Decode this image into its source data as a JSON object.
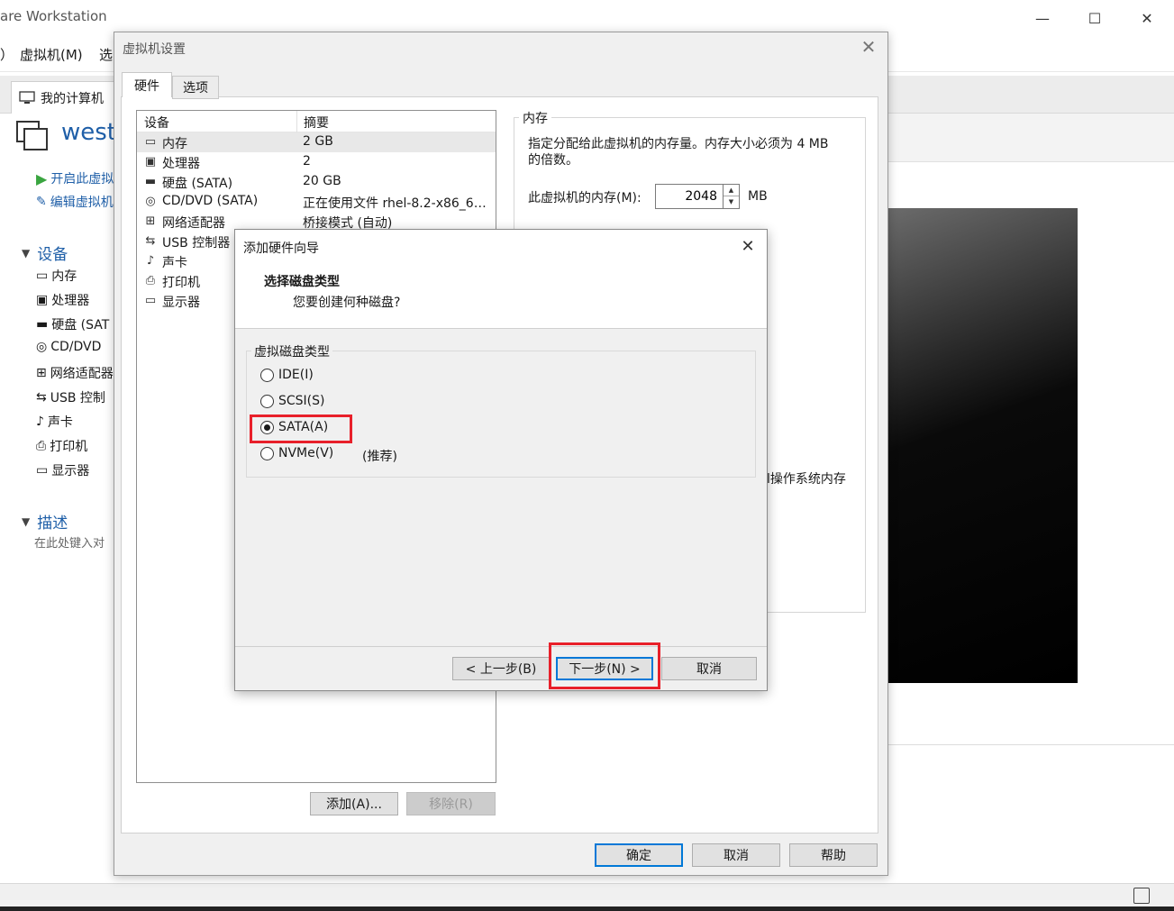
{
  "main_window": {
    "title": "are Workstation",
    "controls": {
      "minimize": "—",
      "maximize": "☐",
      "close": "✕"
    },
    "menu": [
      "）",
      "虚拟机(M)",
      "选"
    ],
    "home_tab": "我的计算机",
    "vm_name": "westo",
    "actions": [
      "开启此虚拟",
      "编辑虚拟机"
    ],
    "devices_section": "设备",
    "devices": [
      "内存",
      "处理器",
      "硬盘 (SAT",
      "CD/DVD",
      "网络适配器",
      "USB 控制",
      "声卡",
      "打印机",
      "显示器"
    ],
    "description_section": "描述",
    "description_hint": "在此处键入对"
  },
  "settings_dialog": {
    "title": "虚拟机设置",
    "close": "✕",
    "tabs": {
      "hardware": "硬件",
      "options": "选项"
    },
    "device_list": {
      "headers": {
        "device": "设备",
        "summary": "摘要"
      },
      "rows": [
        {
          "icon": "memory-icon",
          "glyph": "▭",
          "name": "内存",
          "summary": "2 GB",
          "selected": true
        },
        {
          "icon": "processor-icon",
          "glyph": "▣",
          "name": "处理器",
          "summary": "2"
        },
        {
          "icon": "hard-disk-icon",
          "glyph": "▬",
          "name": "硬盘 (SATA)",
          "summary": "20 GB"
        },
        {
          "icon": "cd-dvd-icon",
          "glyph": "◎",
          "name": "CD/DVD (SATA)",
          "summary": "正在使用文件 rhel-8.2-x86_6…"
        },
        {
          "icon": "network-adapter-icon",
          "glyph": "⊞",
          "name": "网络适配器",
          "summary": "桥接模式 (自动)"
        },
        {
          "icon": "usb-controller-icon",
          "glyph": "⇆",
          "name": "USB 控制器",
          "summary": ""
        },
        {
          "icon": "sound-card-icon",
          "glyph": "♪",
          "name": "声卡",
          "summary": ""
        },
        {
          "icon": "printer-icon",
          "glyph": "⎙",
          "name": "打印机",
          "summary": ""
        },
        {
          "icon": "display-icon",
          "glyph": "▭",
          "name": "显示器",
          "summary": ""
        }
      ]
    },
    "memory_panel": {
      "legend": "内存",
      "desc_line1": "指定分配给此虚拟机的内存量。内存大小必须为 4 MB",
      "desc_line2": "的倍数。",
      "input_label": "此虚拟机的内存(M):",
      "input_value": "2048",
      "unit": "MB",
      "partial_text": "l操作系统内存"
    },
    "buttons": {
      "add": "添加(A)...",
      "remove": "移除(R)",
      "ok": "确定",
      "cancel": "取消",
      "help": "帮助"
    }
  },
  "wizard": {
    "title": "添加硬件向导",
    "close": "✕",
    "heading": "选择磁盘类型",
    "subheading": "您要创建何种磁盘?",
    "group_legend": "虚拟磁盘类型",
    "options": [
      {
        "label": "IDE(I)",
        "selected": false
      },
      {
        "label": "SCSI(S)",
        "selected": false
      },
      {
        "label": "SATA(A)",
        "selected": true
      },
      {
        "label": "NVMe(V)",
        "selected": false
      }
    ],
    "recommended_note": "(推荐)",
    "buttons": {
      "back": "< 上一步(B)",
      "next": "下一步(N) >",
      "cancel": "取消"
    },
    "highlight_color": "#e8202a"
  }
}
